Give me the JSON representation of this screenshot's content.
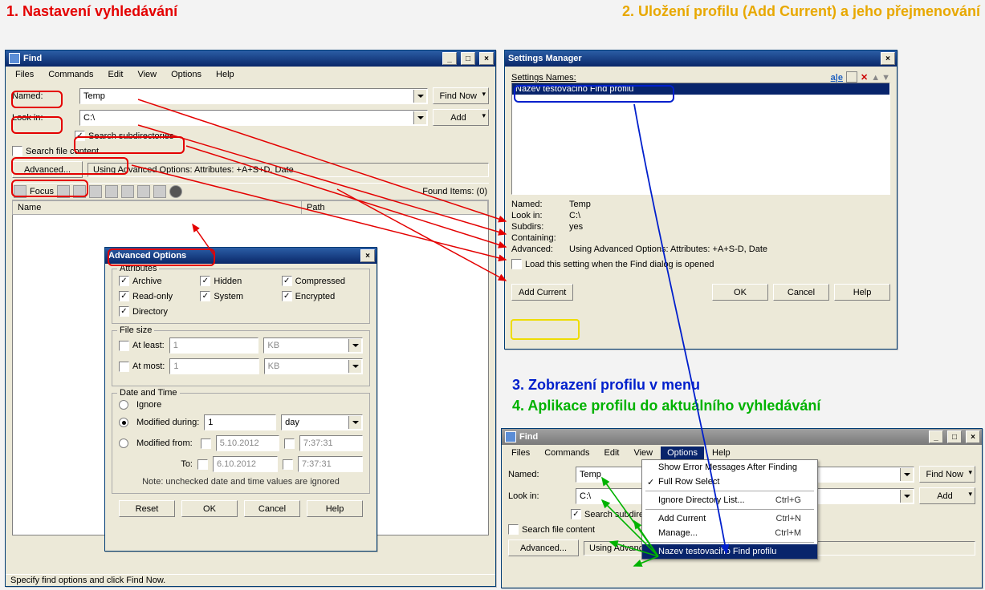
{
  "annotations": {
    "a1": "1. Nastavení vyhledávání",
    "a2": "2. Uložení profilu (Add Current) a jeho přejmenování",
    "a3": "3. Zobrazení profilu v menu",
    "a4": "4. Aplikace profilu do aktuálního vyhledávání"
  },
  "find": {
    "title": "Find",
    "menu": {
      "files": "Files",
      "commands": "Commands",
      "edit": "Edit",
      "view": "View",
      "options": "Options",
      "help": "Help"
    },
    "named_label": "Named:",
    "named_value": "Temp",
    "lookin_label": "Look in:",
    "lookin_value": "C:\\",
    "search_subdirs": "Search subdirectories",
    "search_content": "Search file content",
    "advanced_btn": "Advanced...",
    "advanced_status": "Using Advanced Options: Attributes: +A+S+D, Date",
    "find_now": "Find Now",
    "add": "Add",
    "focus": "Focus",
    "found_items": "Found Items: (0)",
    "col_name": "Name",
    "col_path": "Path",
    "status_text": "Specify find options and click Find Now."
  },
  "adv": {
    "title": "Advanced Options",
    "attributes_legend": "Attributes",
    "archive": "Archive",
    "hidden": "Hidden",
    "compressed": "Compressed",
    "readonly": "Read-only",
    "system": "System",
    "encrypted": "Encrypted",
    "directory": "Directory",
    "filesize_legend": "File size",
    "at_least": "At least:",
    "at_most": "At most:",
    "size_val": "1",
    "size_unit": "KB",
    "datetime_legend": "Date and Time",
    "ignore": "Ignore",
    "mod_during": "Modified during:",
    "during_n": "1",
    "during_unit": "day",
    "mod_from": "Modified from:",
    "to": "To:",
    "date1": "5.10.2012",
    "time1": "7:37:31",
    "date2": "6.10.2012",
    "time2": "7:37:31",
    "note": "Note: unchecked date and time values are ignored",
    "reset": "Reset",
    "ok": "OK",
    "cancel": "Cancel",
    "help": "Help"
  },
  "sm": {
    "title": "Settings Manager",
    "settings_names": "Settings Names:",
    "profile_name": "Nazev testovaciho Find profilu",
    "named": "Named:",
    "named_v": "Temp",
    "lookin": "Look in:",
    "lookin_v": "C:\\",
    "subdirs": "Subdirs:",
    "subdirs_v": "yes",
    "containing": "Containing:",
    "advanced": "Advanced:",
    "advanced_v": "Using Advanced Options: Attributes: +A+S-D, Date",
    "load_on_open": "Load this setting when the Find dialog is opened",
    "add_current": "Add Current",
    "ok": "OK",
    "cancel": "Cancel",
    "help": "Help",
    "rename_hint": "a|e"
  },
  "find2": {
    "title": "Find",
    "menu_options_items": {
      "show_errors": "Show Error Messages After Finding",
      "full_row": "Full Row Select",
      "ignore_list": "Ignore Directory List...",
      "ignore_sc": "Ctrl+G",
      "add_current": "Add Current",
      "add_current_sc": "Ctrl+N",
      "manage": "Manage...",
      "manage_sc": "Ctrl+M",
      "profile": "Nazev testovaciho Find profilu"
    }
  }
}
